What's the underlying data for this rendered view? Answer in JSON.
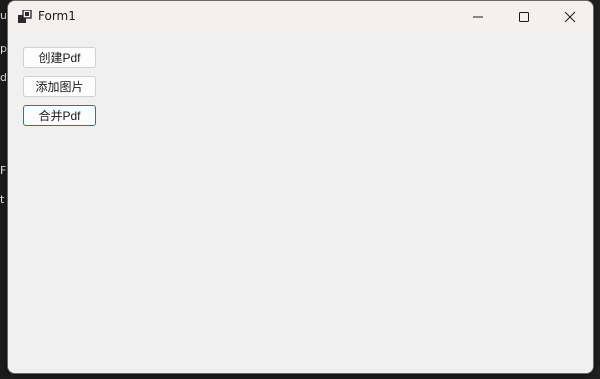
{
  "background_window": {
    "fragments": [
      "ur",
      "p",
      "df",
      "F",
      "t"
    ]
  },
  "window": {
    "title": "Form1",
    "icon": "winforms-app-icon",
    "controls": {
      "minimize_icon": "minimize-icon",
      "maximize_icon": "maximize-icon",
      "close_icon": "close-icon"
    }
  },
  "buttons": [
    {
      "label": "创建Pdf",
      "focused": false
    },
    {
      "label": "添加图片",
      "focused": false
    },
    {
      "label": "合并Pdf",
      "focused": true
    }
  ],
  "colors": {
    "titlebar": "#f7eef0",
    "client": "#f0f0f0",
    "focus_border": "#2f6fb0"
  }
}
